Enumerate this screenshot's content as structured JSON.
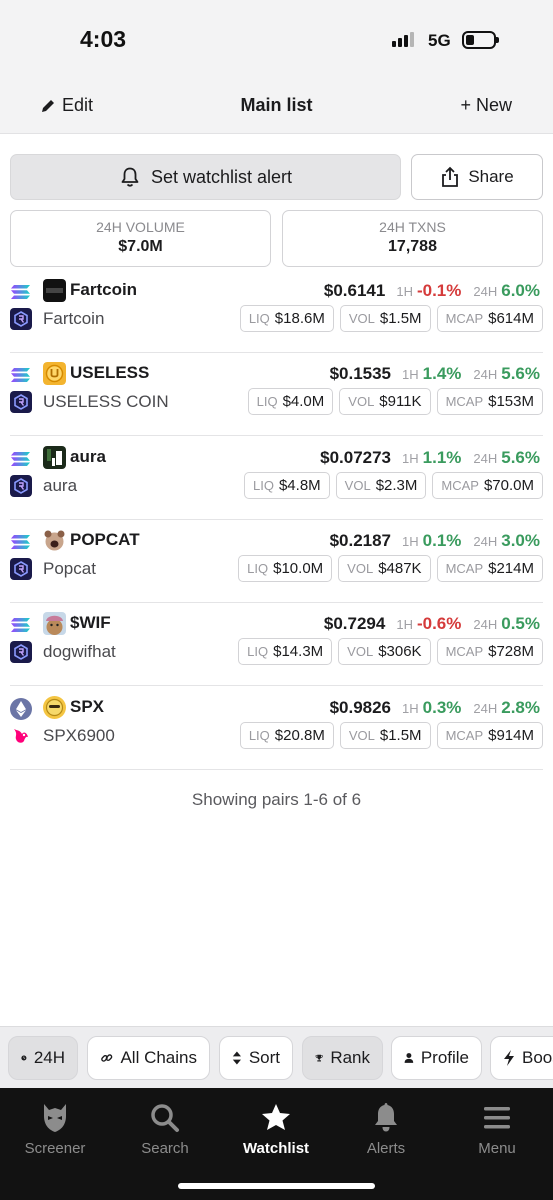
{
  "status_bar": {
    "time": "4:03",
    "network": "5G"
  },
  "nav": {
    "edit": "Edit",
    "title": "Main list",
    "new": "+ New"
  },
  "actions": {
    "alert": "Set watchlist alert",
    "share": "Share"
  },
  "stats": [
    {
      "label": "24H VOLUME",
      "value": "$7.0M"
    },
    {
      "label": "24H TXNS",
      "value": "17,788"
    }
  ],
  "labels": {
    "h1": "1H",
    "h24": "24H",
    "liq": "LIQ",
    "vol": "VOL",
    "mcap": "MCAP"
  },
  "pairs": [
    {
      "symbol": "Fartcoin",
      "name": "Fartcoin",
      "price": "$0.6141",
      "change_1h": "-0.1%",
      "change_24h": "6.0%",
      "liq": "$18.6M",
      "vol": "$1.5M",
      "mcap": "$614M",
      "chain": "solana",
      "dex": "raydium"
    },
    {
      "symbol": "USELESS",
      "name": "USELESS COIN",
      "price": "$0.1535",
      "change_1h": "1.4%",
      "change_24h": "5.6%",
      "liq": "$4.0M",
      "vol": "$911K",
      "mcap": "$153M",
      "chain": "solana",
      "dex": "raydium"
    },
    {
      "symbol": "aura",
      "name": "aura",
      "price": "$0.07273",
      "change_1h": "1.1%",
      "change_24h": "5.6%",
      "liq": "$4.8M",
      "vol": "$2.3M",
      "mcap": "$70.0M",
      "chain": "solana",
      "dex": "raydium"
    },
    {
      "symbol": "POPCAT",
      "name": "Popcat",
      "price": "$0.2187",
      "change_1h": "0.1%",
      "change_24h": "3.0%",
      "liq": "$10.0M",
      "vol": "$487K",
      "mcap": "$214M",
      "chain": "solana",
      "dex": "raydium"
    },
    {
      "symbol": "$WIF",
      "name": "dogwifhat",
      "price": "$0.7294",
      "change_1h": "-0.6%",
      "change_24h": "0.5%",
      "liq": "$14.3M",
      "vol": "$306K",
      "mcap": "$728M",
      "chain": "solana",
      "dex": "raydium"
    },
    {
      "symbol": "SPX",
      "name": "SPX6900",
      "price": "$0.9826",
      "change_1h": "0.3%",
      "change_24h": "2.8%",
      "liq": "$20.8M",
      "vol": "$1.5M",
      "mcap": "$914M",
      "chain": "ethereum",
      "dex": "uniswap"
    }
  ],
  "pairs_count": "Showing pairs 1-6 of 6",
  "filters": [
    {
      "label": "24H",
      "icon": "clock-icon",
      "selected": true
    },
    {
      "label": "All Chains",
      "icon": "link-icon",
      "selected": false
    },
    {
      "label": "Sort",
      "icon": "sort-icon",
      "selected": false
    },
    {
      "label": "Rank",
      "icon": "trophy-icon",
      "selected": true
    },
    {
      "label": "Profile",
      "icon": "user-icon",
      "selected": false
    },
    {
      "label": "Boos",
      "icon": "bolt-icon",
      "selected": false
    }
  ],
  "tabs": [
    {
      "label": "Screener",
      "icon": "screener-icon",
      "active": false
    },
    {
      "label": "Search",
      "icon": "search-icon",
      "active": false
    },
    {
      "label": "Watchlist",
      "icon": "star-icon",
      "active": true
    },
    {
      "label": "Alerts",
      "icon": "bell-icon",
      "active": false
    },
    {
      "label": "Menu",
      "icon": "menu-icon",
      "active": false
    }
  ],
  "colors": {
    "up": "#3a9b5e",
    "down": "#d53b3b",
    "tab_bg": "#121212"
  }
}
